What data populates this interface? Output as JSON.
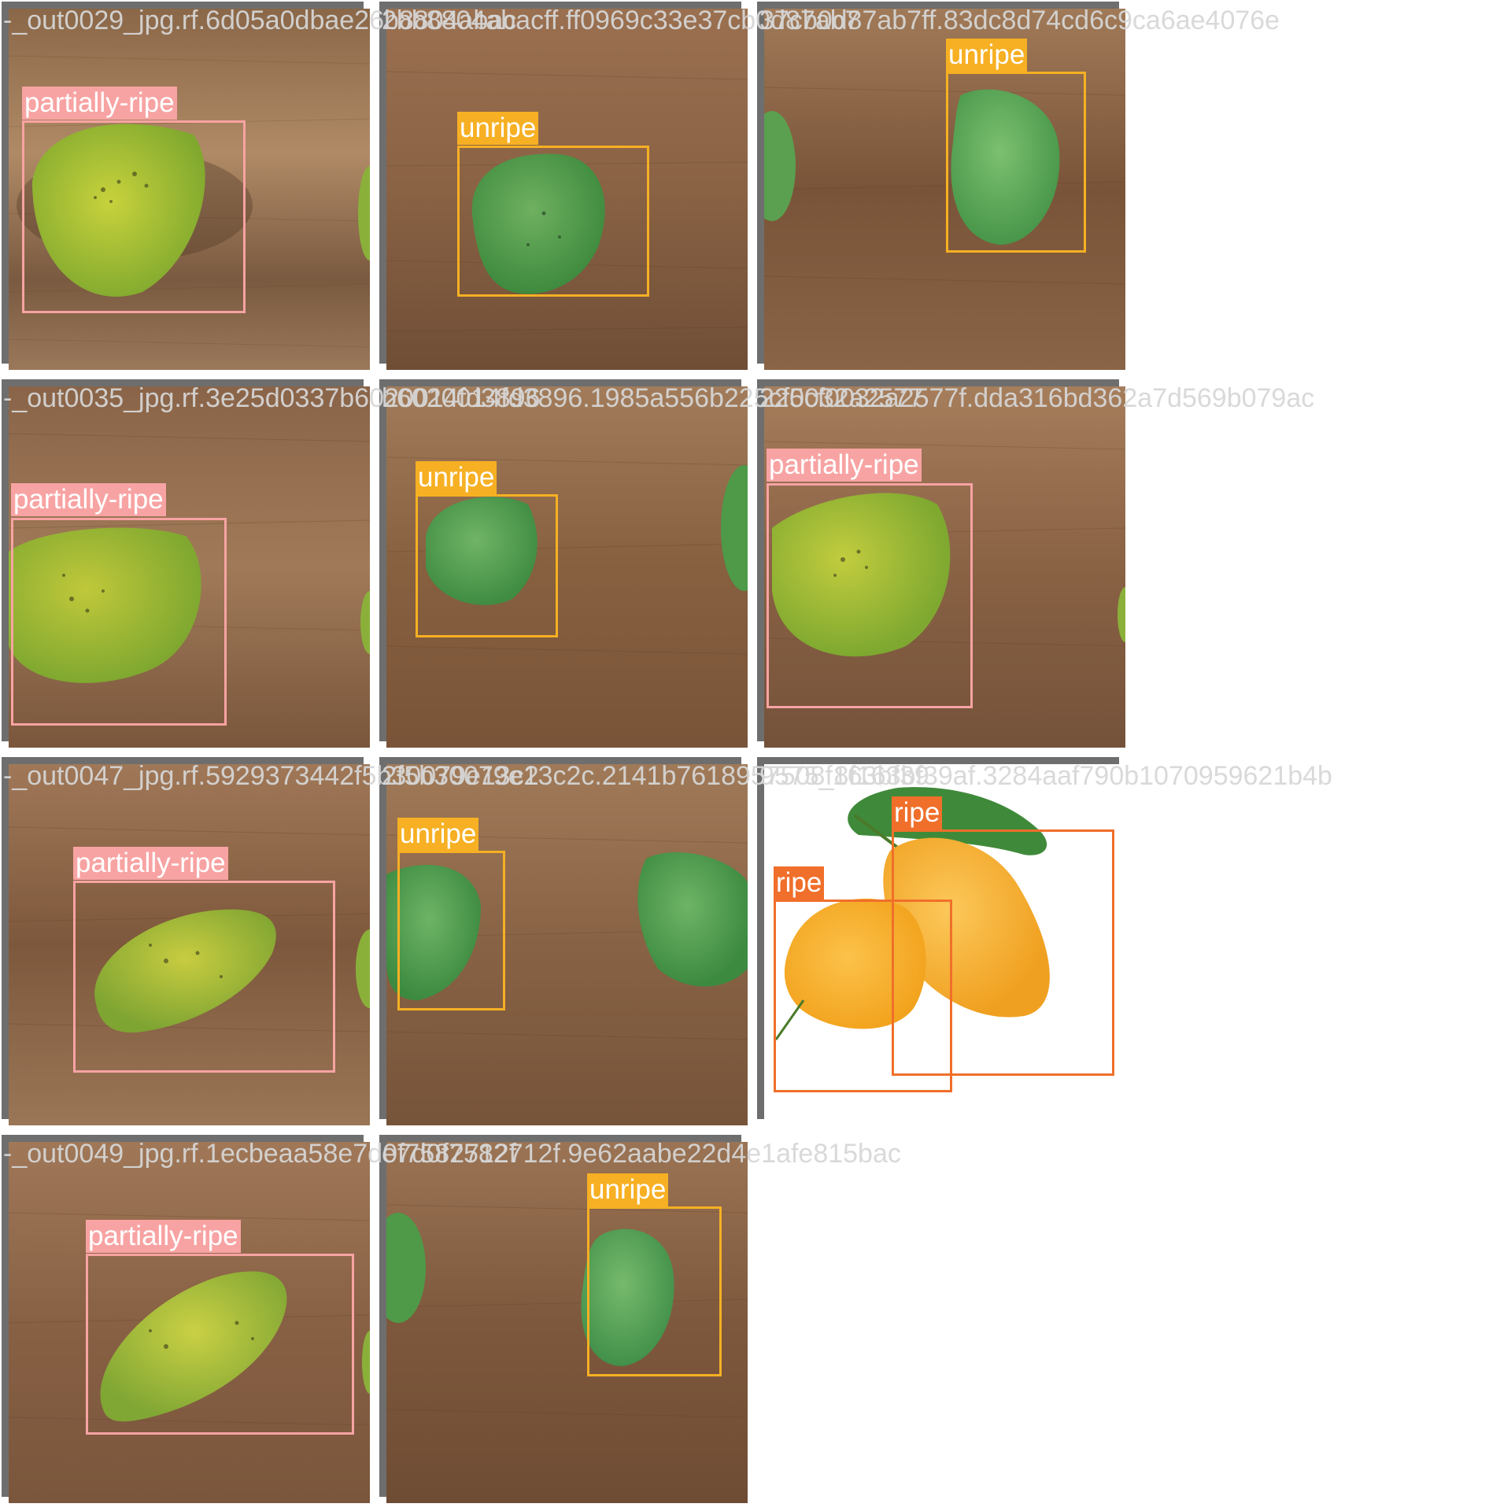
{
  "colors": {
    "partially-ripe": "#f8a3a3",
    "unripe": "#f7b023",
    "ripe": "#f06f2a",
    "tile_border": "#6e6e6e",
    "filename_text": "#d7d7d7"
  },
  "tiles": [
    {
      "filename": "-_out0029_jpg.rf.6d05a0dbae26b8804abac",
      "scene": "table",
      "detections": [
        {
          "label": "partially-ripe",
          "fruit": "yellow-green mango"
        }
      ]
    },
    {
      "filename": "2bb8804abacff.ff0969c33e37cb0d87ab7",
      "scene": "table",
      "detections": [
        {
          "label": "unripe",
          "fruit": "green mango"
        }
      ]
    },
    {
      "filename": "37cb0d87ab7ff.83dc8d74cd6c9ca6ae4076e",
      "scene": "table",
      "detections": [
        {
          "label": "unripe",
          "fruit": "green mango"
        }
      ]
    },
    {
      "filename": "-_out0035_jpg.rf.3e25d0337b6020014fd3896",
      "scene": "table",
      "detections": [
        {
          "label": "partially-ripe",
          "fruit": "yellow-green mango"
        }
      ]
    },
    {
      "filename": "b6020014fd3896.1985a556b225cf0032a2577",
      "scene": "table",
      "detections": [
        {
          "label": "unripe",
          "fruit": "green mango"
        }
      ]
    },
    {
      "filename": "225cf0032a2577f.dda316bd362a7d569b079ac",
      "scene": "table",
      "detections": [
        {
          "label": "partially-ripe",
          "fruit": "yellow-green mango"
        }
      ]
    },
    {
      "filename": "-_out0047_jpg.rf.5929373442f5b30079e13c2",
      "scene": "table",
      "detections": [
        {
          "label": "partially-ripe",
          "fruit": "yellow-green mango"
        }
      ]
    },
    {
      "filename": "2f5b30079e13c2c.2141b7618957508f163bf39",
      "scene": "table",
      "detections": [
        {
          "label": "unripe",
          "fruit": "green mango"
        }
      ]
    },
    {
      "filename": "9575_8f163bf39af.3284aaf790b1070959621b4b",
      "scene": "white",
      "detections": [
        {
          "label": "ripe",
          "fruit": "yellow mango"
        },
        {
          "label": "ripe",
          "fruit": "yellow mango with leaf"
        }
      ]
    },
    {
      "filename": "-_out0049_jpg.rf.1ecbeaa58e7d0f7582712f",
      "scene": "table",
      "detections": [
        {
          "label": "partially-ripe",
          "fruit": "yellow-green mango"
        }
      ]
    },
    {
      "filename": "e7d0f7582712f.9e62aabe22d4e1afe815bac",
      "scene": "table",
      "detections": [
        {
          "label": "unripe",
          "fruit": "green mango"
        }
      ]
    }
  ]
}
